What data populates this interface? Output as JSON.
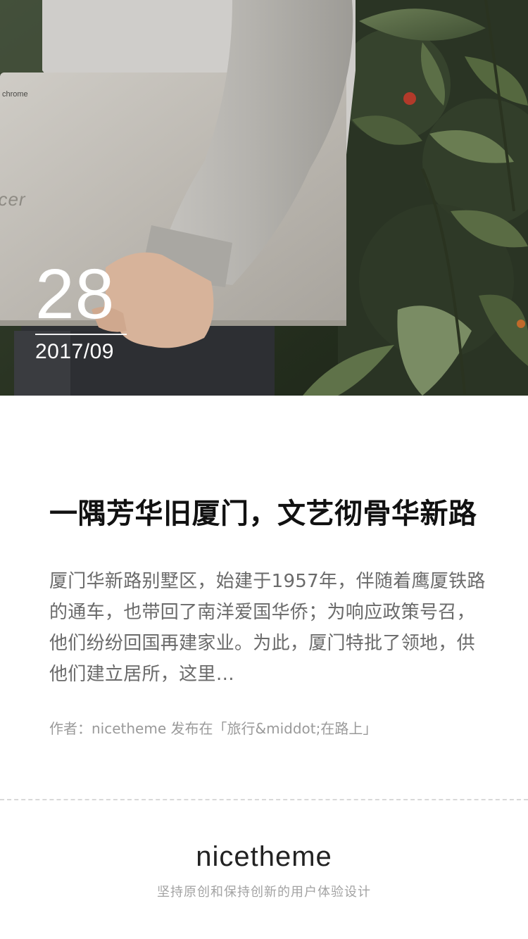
{
  "hero": {
    "day": "28",
    "year_month": "2017/09",
    "laptop_brand": "chrome",
    "laptop_logo": "acer"
  },
  "article": {
    "title": "一隅芳华旧厦门，文艺彻骨华新路",
    "excerpt": "厦门华新路别墅区，始建于1957年，伴随着鹰厦铁路的通车，也带回了南洋爱国华侨；为响应政策号召，他们纷纷回国再建家业。为此，厦门特批了领地，供他们建立居所，这里…",
    "meta": "作者：nicetheme 发布在「旅行&middot;在路上」"
  },
  "footer": {
    "brand": "nicetheme",
    "tagline": "坚持原创和保持创新的用户体验设计"
  },
  "colors": {
    "title": "#111111",
    "excerpt": "#6a6a6a",
    "meta": "#9a9a9a",
    "divider": "#d9d9d9"
  }
}
